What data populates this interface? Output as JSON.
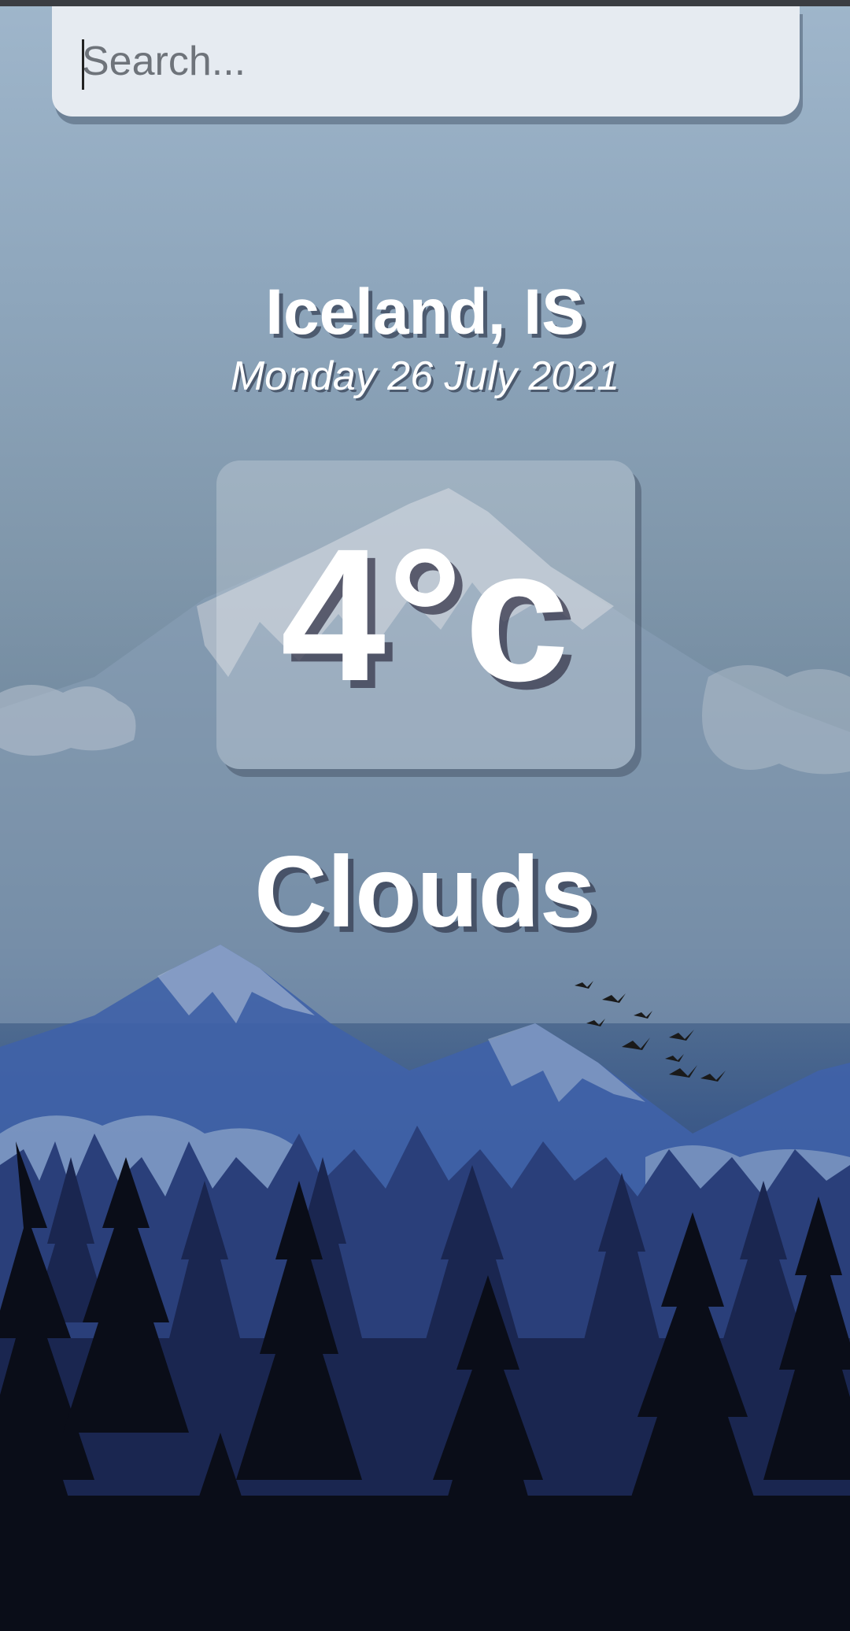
{
  "search": {
    "placeholder": "Search...",
    "value": ""
  },
  "weather": {
    "location": "Iceland, IS",
    "date": "Monday 26 July 2021",
    "temperature": "4°c",
    "condition": "Clouds"
  },
  "background": {
    "scene": "mountain-forest-illustration",
    "birds_icon": "birds-flock-icon"
  }
}
